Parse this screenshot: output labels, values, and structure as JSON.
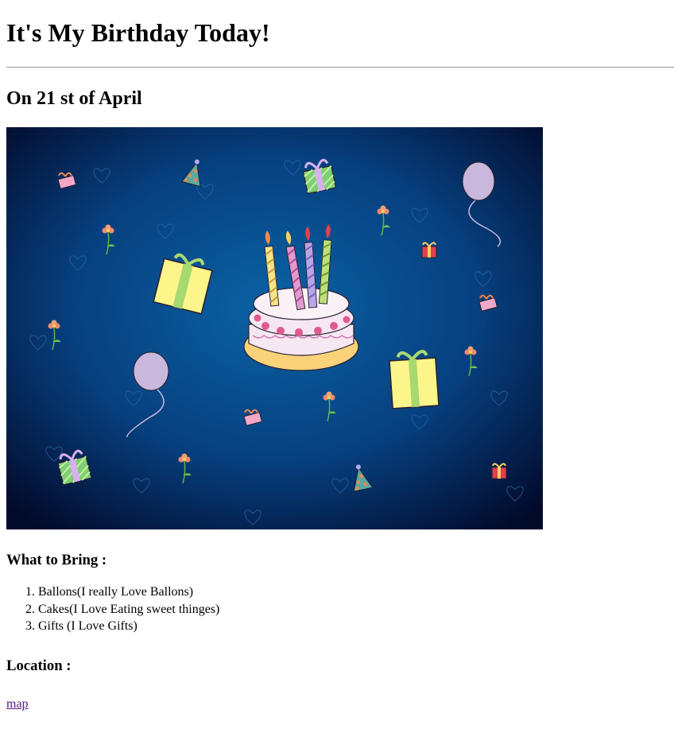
{
  "page": {
    "title": "It's My Birthday Today!",
    "subtitle": "On 21 st of April"
  },
  "banner": {
    "background_center": "#0a63a5",
    "background_edge": "#020a2a",
    "cake_frosting": "#f6e8f2",
    "cake_plate": "#f9d27a",
    "gift_yellow": "#fbf58a",
    "gift_green": "#7ecf74",
    "gift_red": "#e04050",
    "balloon_color": "#c9b8dc",
    "candle_colors": [
      "#f4e58a",
      "#e09ad0",
      "#b8a6e6",
      "#bde07a"
    ]
  },
  "bring": {
    "heading": "What to Bring :",
    "items": [
      "Ballons(I really Love Ballons)",
      "Cakes(I Love Eating sweet thinges)",
      "Gifts (I Love Gifts)"
    ]
  },
  "location": {
    "heading": "Location :",
    "link_label": "map"
  }
}
